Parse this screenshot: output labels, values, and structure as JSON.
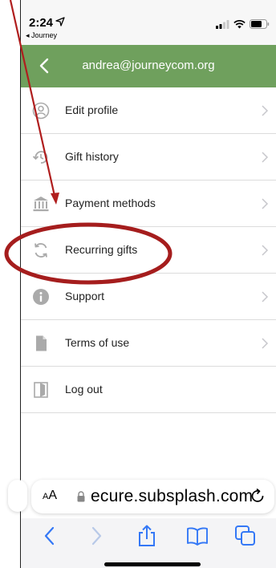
{
  "status_bar": {
    "time": "2:24",
    "back_app": "◂ Journey"
  },
  "header": {
    "title": "andrea@journeycom.org"
  },
  "menu": {
    "items": [
      {
        "label": "Edit profile",
        "icon": "user-circle-icon",
        "has_chevron": true
      },
      {
        "label": "Gift history",
        "icon": "history-icon",
        "has_chevron": true
      },
      {
        "label": "Payment methods",
        "icon": "bank-icon",
        "has_chevron": true
      },
      {
        "label": "Recurring gifts",
        "icon": "recurring-icon",
        "has_chevron": true
      },
      {
        "label": "Support",
        "icon": "info-icon",
        "has_chevron": true
      },
      {
        "label": "Terms of use",
        "icon": "document-icon",
        "has_chevron": true
      },
      {
        "label": "Log out",
        "icon": "logout-icon",
        "has_chevron": false
      }
    ]
  },
  "browser": {
    "aa_large": "A",
    "aa_small": "A",
    "url": "ecure.subsplash.com"
  },
  "colors": {
    "header_bg": "#6fa05d",
    "accent_blue": "#3478f6",
    "annotation_red": "#b01e1e"
  }
}
